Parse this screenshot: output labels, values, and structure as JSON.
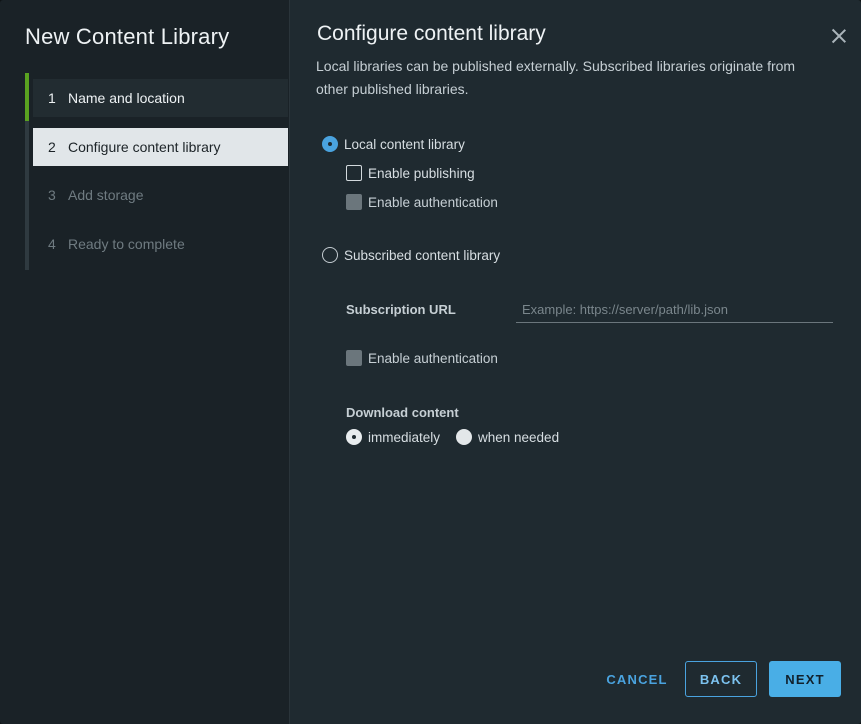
{
  "wizard": {
    "title": "New Content Library",
    "steps": [
      {
        "num": "1",
        "label": "Name and location"
      },
      {
        "num": "2",
        "label": "Configure content library"
      },
      {
        "num": "3",
        "label": "Add storage"
      },
      {
        "num": "4",
        "label": "Ready to complete"
      }
    ]
  },
  "page": {
    "title": "Configure content library",
    "description": "Local libraries can be published externally. Subscribed libraries originate from other published libraries."
  },
  "local": {
    "label": "Local content library",
    "enable_publishing": "Enable publishing",
    "enable_authentication": "Enable authentication"
  },
  "subscribed": {
    "label": "Subscribed content library",
    "url_label": "Subscription URL",
    "url_placeholder": "Example: https://server/path/lib.json",
    "url_value": "",
    "enable_authentication": "Enable authentication",
    "download_label": "Download content",
    "download_immediately": "immediately",
    "download_when_needed": "when needed"
  },
  "footer": {
    "cancel": "CANCEL",
    "back": "BACK",
    "next": "NEXT"
  },
  "colors": {
    "accent": "#4aa3df",
    "step_done": "#5aa220"
  }
}
